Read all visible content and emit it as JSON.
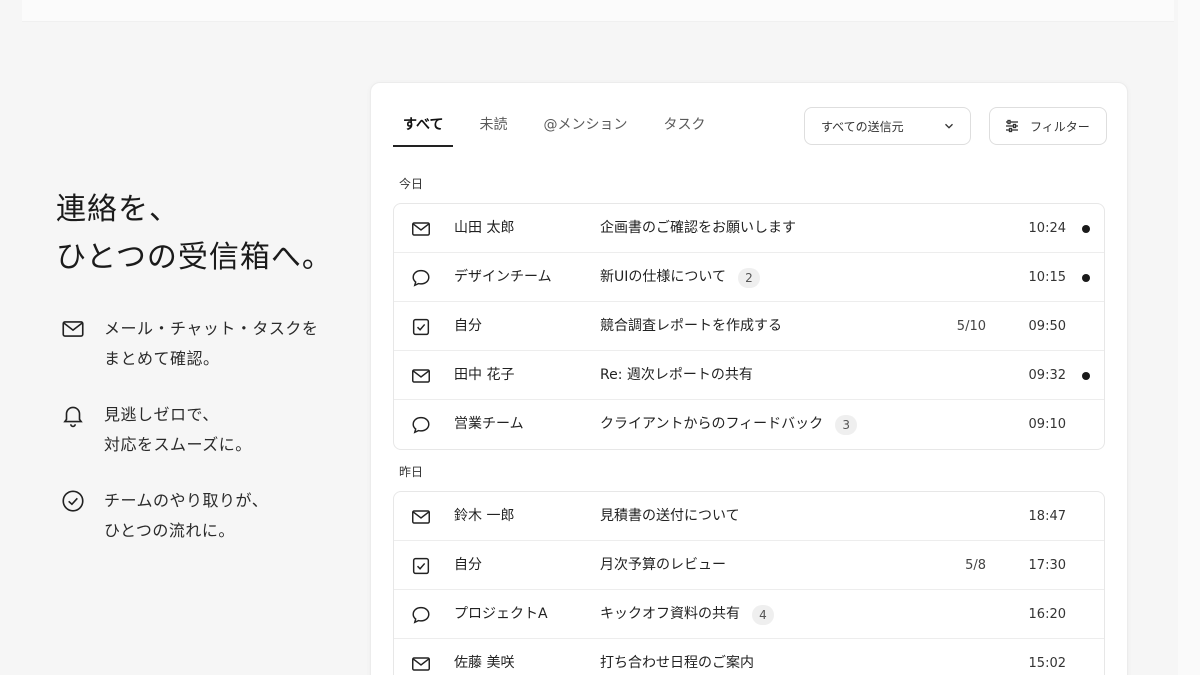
{
  "hero": {
    "title_line1": "連絡を、",
    "title_line2": "ひとつの受信箱へ。"
  },
  "features": [
    {
      "icon": "mail-icon",
      "line1": "メール・チャット・タスクを",
      "line2": "まとめて確認。"
    },
    {
      "icon": "bell-icon",
      "line1": "見逃しゼロで、",
      "line2": "対応をスムーズに。"
    },
    {
      "icon": "check-circle-icon",
      "line1": "チームのやり取りが、",
      "line2": "ひとつの流れに。"
    }
  ],
  "tabs": [
    {
      "label": "すべて",
      "active": true
    },
    {
      "label": "未読",
      "active": false
    },
    {
      "label": "@メンション",
      "active": false
    },
    {
      "label": "タスク",
      "active": false
    }
  ],
  "toolbar": {
    "sender_select": "すべての送信元",
    "filter_label": "フィルター"
  },
  "sections": [
    {
      "label": "今日",
      "rows": [
        {
          "type": "mail",
          "sender": "山田 太郎",
          "subject": "企画書のご確認をお願いします",
          "count": "",
          "progress": "",
          "time": "10:24",
          "unread": true
        },
        {
          "type": "chat",
          "sender": "デザインチーム",
          "subject": "新UIの仕様について",
          "count": "2",
          "progress": "",
          "time": "10:15",
          "unread": true
        },
        {
          "type": "task",
          "sender": "自分",
          "subject": "競合調査レポートを作成する",
          "count": "",
          "progress": "5/10",
          "time": "09:50",
          "unread": false
        },
        {
          "type": "mail",
          "sender": "田中 花子",
          "subject": "Re: 週次レポートの共有",
          "count": "",
          "progress": "",
          "time": "09:32",
          "unread": true
        },
        {
          "type": "chat",
          "sender": "営業チーム",
          "subject": "クライアントからのフィードバック",
          "count": "3",
          "progress": "",
          "time": "09:10",
          "unread": false
        }
      ]
    },
    {
      "label": "昨日",
      "rows": [
        {
          "type": "mail",
          "sender": "鈴木 一郎",
          "subject": "見積書の送付について",
          "count": "",
          "progress": "",
          "time": "18:47",
          "unread": false
        },
        {
          "type": "task",
          "sender": "自分",
          "subject": "月次予算のレビュー",
          "count": "",
          "progress": "5/8",
          "time": "17:30",
          "unread": false
        },
        {
          "type": "chat",
          "sender": "プロジェクトA",
          "subject": "キックオフ資料の共有",
          "count": "4",
          "progress": "",
          "time": "16:20",
          "unread": false
        },
        {
          "type": "mail",
          "sender": "佐藤 美咲",
          "subject": "打ち合わせ日程のご案内",
          "count": "",
          "progress": "",
          "time": "15:02",
          "unread": false
        }
      ]
    }
  ],
  "colors": {
    "text": "#1f1f1f",
    "unread_dot": "#1a1a1a",
    "badge_bg": "#efefef",
    "background": "#f6f6f6"
  }
}
